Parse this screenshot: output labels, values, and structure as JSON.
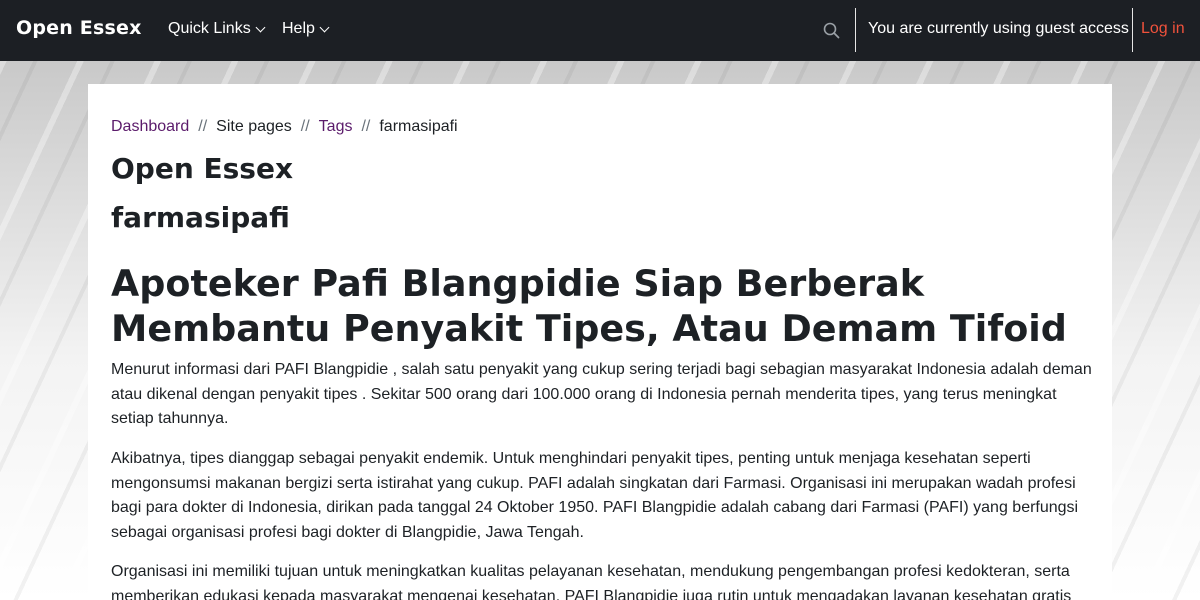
{
  "navbar": {
    "brand": "Open Essex",
    "quick_links": "Quick Links",
    "help": "Help",
    "guest_text": "You are currently using guest access",
    "login": "Log in",
    "colors": {
      "background": "#1c1f24",
      "login": "#f0523c"
    }
  },
  "breadcrumb": {
    "items": [
      "Dashboard",
      "Site pages",
      "Tags",
      "farmasipafi"
    ],
    "separator": "//",
    "link_color": "#5b1b6b"
  },
  "page": {
    "site_title": "Open Essex",
    "tag_title": "farmasipafi",
    "article_title": "Apoteker Pafi Blangpidie Siap Berberak Membantu Penyakit Tipes, Atau Demam Tifoid",
    "paragraphs": [
      "Menurut informasi dari PAFI Blangpidie , salah satu penyakit yang cukup sering terjadi bagi sebagian masyarakat Indonesia adalah deman atau dikenal dengan penyakit tipes . Sekitar 500 orang dari 100.000 orang di Indonesia pernah menderita tipes, yang terus meningkat setiap tahunnya.",
      "Akibatnya, tipes dianggap sebagai penyakit endemik. Untuk menghindari penyakit tipes, penting untuk menjaga kesehatan seperti mengonsumsi makanan bergizi serta istirahat yang cukup. PAFI adalah singkatan dari Farmasi. Organisasi ini merupakan wadah profesi bagi para dokter di Indonesia, dirikan pada tanggal 24 Oktober 1950. PAFI Blangpidie adalah cabang dari Farmasi (PAFI) yang berfungsi sebagai organisasi profesi bagi dokter di Blangpidie, Jawa Tengah.",
      "Organisasi ini memiliki tujuan untuk meningkatkan kualitas pelayanan kesehatan, mendukung pengembangan profesi kedokteran, serta memberikan edukasi kepada masyarakat mengenai kesehatan. PAFI Blangpidie juga rutin untuk mengadakan layanan kesehatan gratis"
    ]
  },
  "icons": {
    "search": "search-icon",
    "dropdown": "chevron-down-icon"
  }
}
